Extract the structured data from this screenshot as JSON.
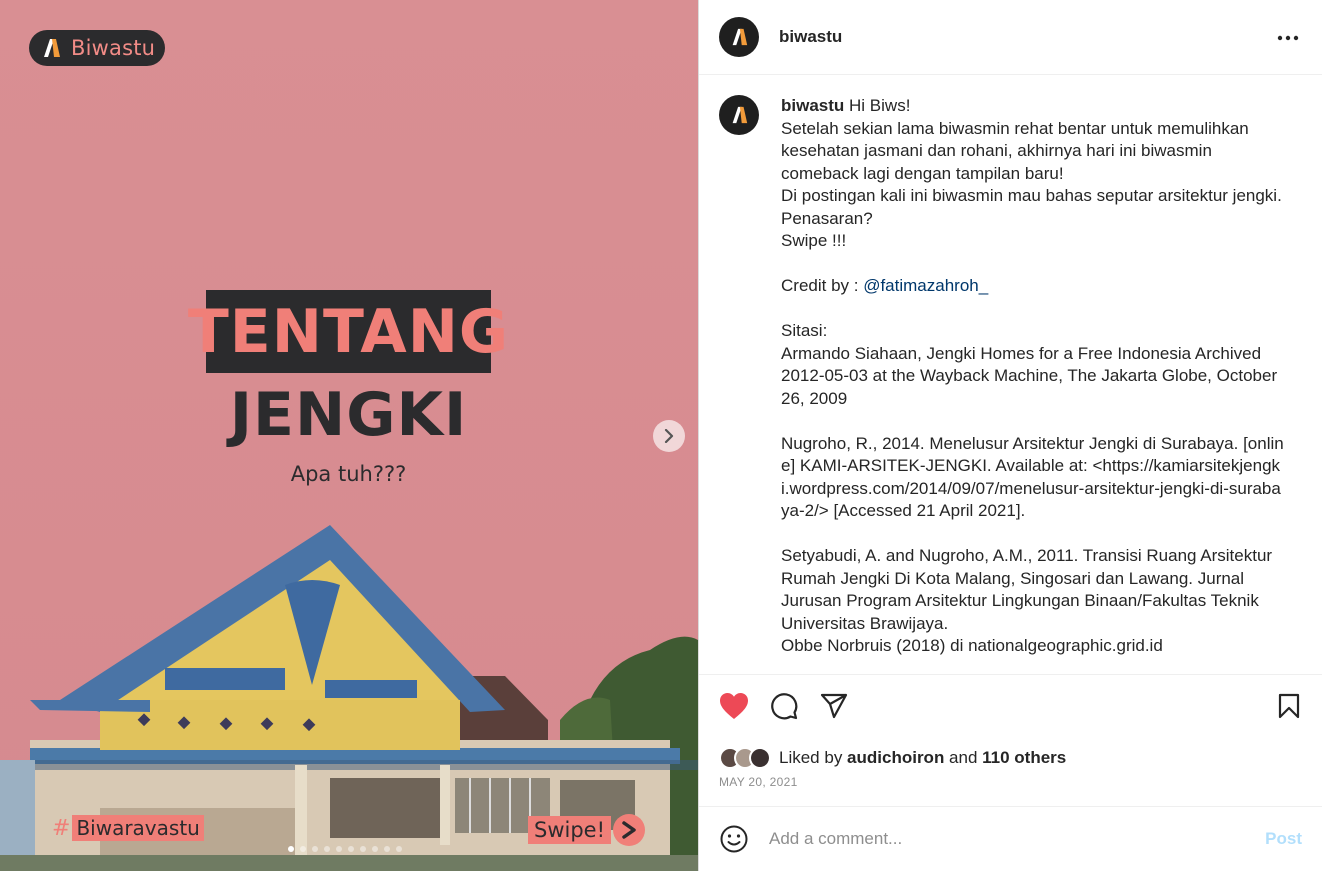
{
  "media": {
    "brand_label": "Biwastu",
    "title_line1": "TENTANG",
    "title_line2": "JENGKI",
    "subtitle": "Apa tuh???",
    "hashtag_symbol": "#",
    "hashtag_text": "Biwaravastu",
    "swipe_label": "Swipe!",
    "carousel_count": 10,
    "carousel_active": 1
  },
  "header": {
    "username": "biwastu"
  },
  "caption": {
    "username": "biwastu",
    "lines": [
      {
        "text": " Hi Biws!"
      },
      {
        "text": "Setelah sekian lama biwasmin rehat bentar untuk memulihkan kesehatan jasmani dan rohani, akhirnya hari ini biwasmin comeback lagi dengan tampilan baru!"
      },
      {
        "text": "Di postingan kali ini biwasmin mau bahas seputar arsitektur jengki. Penasaran?"
      },
      {
        "text": "Swipe !!!"
      },
      {
        "text": ""
      },
      {
        "text": "Credit by : ",
        "mention": "@fatimazahroh_"
      },
      {
        "text": ""
      },
      {
        "text": "Sitasi:"
      },
      {
        "text": "Armando Siahaan, Jengki Homes for a Free Indonesia Archived 2012-05-03 at the Wayback Machine, The Jakarta Globe, October 26, 2009"
      },
      {
        "text": ""
      },
      {
        "text": "Nugroho, R., 2014. Menelusur Arsitektur Jengki di Surabaya. [online] KAMI-ARSITEK-JENGKI. Available at: <https://kamiarsitekjengki.wordpress.com/2014/09/07/menelusur-arsitektur-jengki-di-surabaya-2/> [Accessed 21 April 2021]."
      },
      {
        "text": ""
      },
      {
        "text": "Setyabudi, A. and Nugroho, A.M., 2011. Transisi Ruang Arsitektur Rumah Jengki Di Kota Malang, Singosari dan Lawang. Jurnal Jurusan Program Arsitektur Lingkungan Binaan/Fakultas Teknik Universitas Brawijaya."
      },
      {
        "text": "Obbe Norbruis (2018) di nationalgeographic.grid.id"
      }
    ]
  },
  "likes": {
    "prefix": "Liked by ",
    "user": "audichoiron",
    "middle": " and ",
    "others": "110 others"
  },
  "date": "MAY 20, 2021",
  "comment": {
    "placeholder": "Add a comment...",
    "post_label": "Post"
  },
  "colors": {
    "wall": "#d98e92",
    "accent": "#f07f78",
    "dark": "#2b2b2d",
    "like_red": "#ed4956",
    "link": "#00376b",
    "post_disabled": "#b2dffc"
  },
  "icons": [
    "biwastu-logo-icon",
    "more-options-icon",
    "heart-icon",
    "comment-icon",
    "share-icon",
    "bookmark-icon",
    "emoji-icon",
    "chevron-right-icon",
    "swipe-arrow-icon"
  ]
}
